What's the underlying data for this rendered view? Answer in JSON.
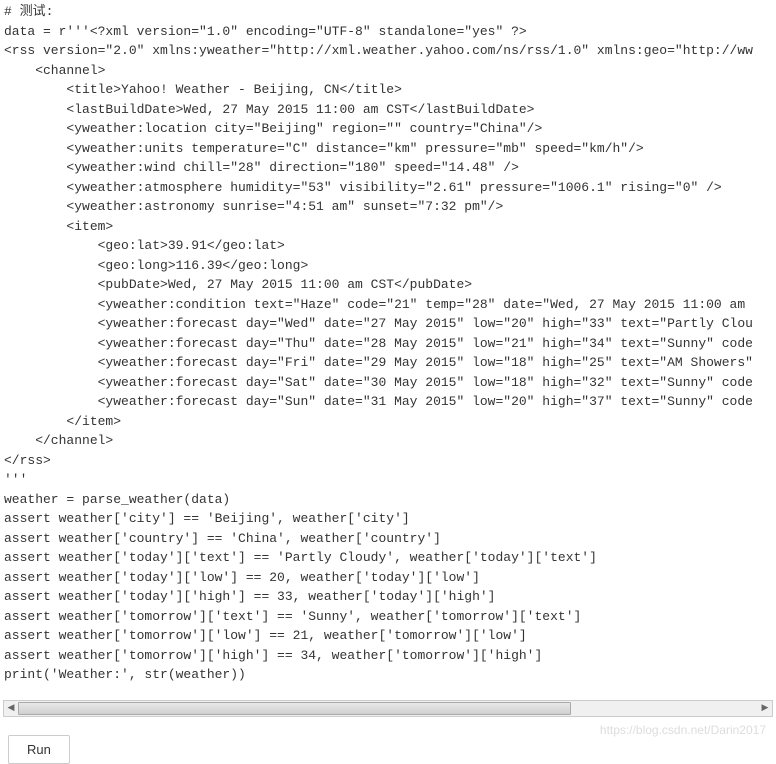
{
  "code": {
    "lines": [
      "# 测试:",
      "data = r'''<?xml version=\"1.0\" encoding=\"UTF-8\" standalone=\"yes\" ?>",
      "<rss version=\"2.0\" xmlns:yweather=\"http://xml.weather.yahoo.com/ns/rss/1.0\" xmlns:geo=\"http://ww",
      "    <channel>",
      "        <title>Yahoo! Weather - Beijing, CN</title>",
      "        <lastBuildDate>Wed, 27 May 2015 11:00 am CST</lastBuildDate>",
      "        <yweather:location city=\"Beijing\" region=\"\" country=\"China\"/>",
      "        <yweather:units temperature=\"C\" distance=\"km\" pressure=\"mb\" speed=\"km/h\"/>",
      "        <yweather:wind chill=\"28\" direction=\"180\" speed=\"14.48\" />",
      "        <yweather:atmosphere humidity=\"53\" visibility=\"2.61\" pressure=\"1006.1\" rising=\"0\" />",
      "        <yweather:astronomy sunrise=\"4:51 am\" sunset=\"7:32 pm\"/>",
      "        <item>",
      "            <geo:lat>39.91</geo:lat>",
      "            <geo:long>116.39</geo:long>",
      "            <pubDate>Wed, 27 May 2015 11:00 am CST</pubDate>",
      "            <yweather:condition text=\"Haze\" code=\"21\" temp=\"28\" date=\"Wed, 27 May 2015 11:00 am",
      "            <yweather:forecast day=\"Wed\" date=\"27 May 2015\" low=\"20\" high=\"33\" text=\"Partly Clou",
      "            <yweather:forecast day=\"Thu\" date=\"28 May 2015\" low=\"21\" high=\"34\" text=\"Sunny\" code",
      "            <yweather:forecast day=\"Fri\" date=\"29 May 2015\" low=\"18\" high=\"25\" text=\"AM Showers\"",
      "            <yweather:forecast day=\"Sat\" date=\"30 May 2015\" low=\"18\" high=\"32\" text=\"Sunny\" code",
      "            <yweather:forecast day=\"Sun\" date=\"31 May 2015\" low=\"20\" high=\"37\" text=\"Sunny\" code",
      "        </item>",
      "    </channel>",
      "</rss>",
      "'''",
      "weather = parse_weather(data)",
      "assert weather['city'] == 'Beijing', weather['city']",
      "assert weather['country'] == 'China', weather['country']",
      "assert weather['today']['text'] == 'Partly Cloudy', weather['today']['text']",
      "assert weather['today']['low'] == 20, weather['today']['low']",
      "assert weather['today']['high'] == 33, weather['today']['high']",
      "assert weather['tomorrow']['text'] == 'Sunny', weather['tomorrow']['text']",
      "assert weather['tomorrow']['low'] == 21, weather['tomorrow']['low']",
      "assert weather['tomorrow']['high'] == 34, weather['tomorrow']['high']",
      "print('Weather:', str(weather))"
    ]
  },
  "controls": {
    "run_label": "Run"
  },
  "watermark": "https://blog.csdn.net/Darin2017"
}
